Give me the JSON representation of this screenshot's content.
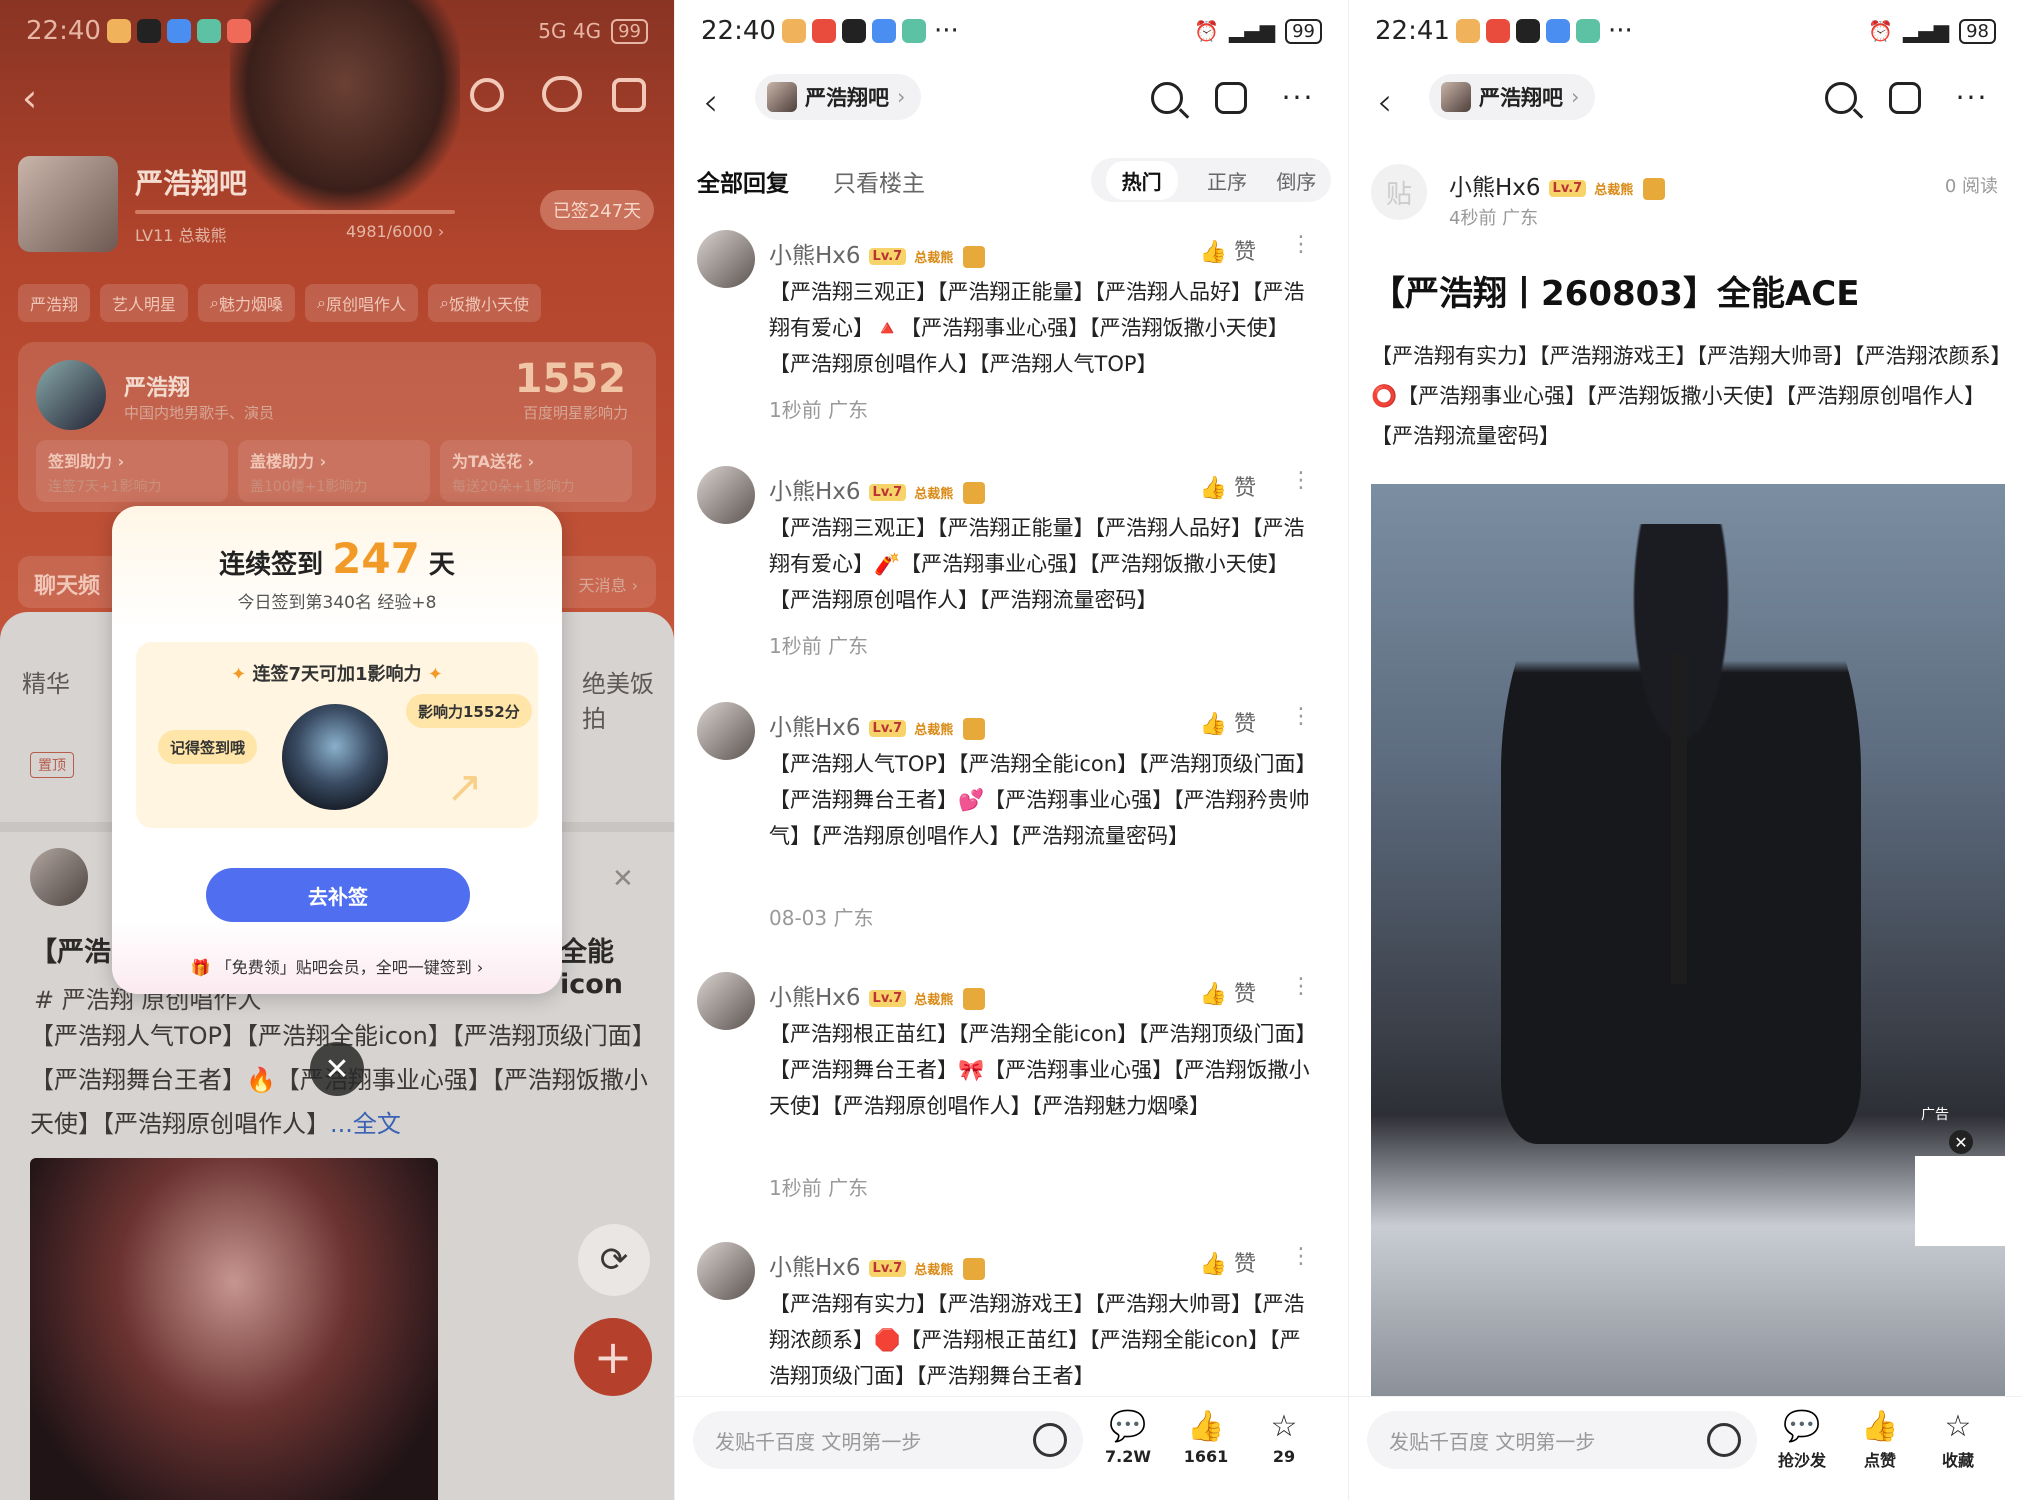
{
  "screens": [
    {
      "status": {
        "time": "22:40",
        "net": "5G 4G",
        "battery": "99"
      },
      "forum": {
        "name": "严浩翔吧",
        "level": "LV11 总裁熊",
        "exp": "4981/6000 ›",
        "signed": "已签247天"
      },
      "tags": [
        "严浩翔",
        "艺人明星",
        "魅力烟嗓",
        "原创唱作人",
        "饭撒小天使"
      ],
      "star_card": {
        "name": "严浩翔",
        "desc": "中国内地男歌手、演员",
        "score": "1552",
        "score_label": "百度明星影响力",
        "actions": [
          {
            "title": "签到助力 ›",
            "sub": "连签7天+1影响力"
          },
          {
            "title": "盖楼助力 ›",
            "sub": "盖100楼+1影响力"
          },
          {
            "title": "为TA送花 ›",
            "sub": "每送20朵+1影响力"
          }
        ]
      },
      "chat": {
        "label": "聊天频",
        "right": "天消息 ›"
      },
      "tabs": {
        "first": "精华",
        "last": "绝美饭拍"
      },
      "pin": "置顶",
      "post": {
        "title": "【严浩",
        "title_tail": "全能icon",
        "hashtag": "# 严浩翔 原创唱作人",
        "text": "【严浩翔人气TOP】【严浩翔全能icon】【严浩翔顶级门面】【严浩翔舞台王者】🔥【严浩翔事业心强】【严浩翔饭撒小天使】【严浩翔原创唱作人】",
        "more": "...全文"
      },
      "modal": {
        "title_pre": "连续签到",
        "days": "247",
        "title_post": "天",
        "sub": "今日签到第340名 经验+8",
        "box_title": "连签7天可加1影响力",
        "chip_left": "记得签到哦",
        "chip_right": "影响力1552分",
        "button": "去补签",
        "footer": "「免费领」贴吧会员，全吧一键签到 ›"
      }
    },
    {
      "status": {
        "time": "22:40",
        "battery": "99"
      },
      "forum_pill": "严浩翔吧",
      "tabs": {
        "all": "全部回复",
        "op": "只看楼主",
        "seg": [
          "热门",
          "正序",
          "倒序"
        ]
      },
      "replies": [
        {
          "name": "小熊Hx6",
          "lv": "Lv.7",
          "badge": "总裁熊",
          "like": "赞",
          "text": "【严浩翔三观正】【严浩翔正能量】【严浩翔人品好】【严浩翔有爱心】🔺【严浩翔事业心强】【严浩翔饭撒小天使】【严浩翔原创唱作人】【严浩翔人气TOP】",
          "meta": "1秒前  广东"
        },
        {
          "name": "小熊Hx6",
          "lv": "Lv.7",
          "badge": "总裁熊",
          "like": "赞",
          "text": "【严浩翔三观正】【严浩翔正能量】【严浩翔人品好】【严浩翔有爱心】🧨【严浩翔事业心强】【严浩翔饭撒小天使】【严浩翔原创唱作人】【严浩翔流量密码】",
          "meta": "1秒前  广东"
        },
        {
          "name": "小熊Hx6",
          "lv": "Lv.7",
          "badge": "总裁熊",
          "like": "赞",
          "text": "【严浩翔人气TOP】【严浩翔全能icon】【严浩翔顶级门面】【严浩翔舞台王者】💕【严浩翔事业心强】【严浩翔矜贵帅气】【严浩翔原创唱作人】【严浩翔流量密码】",
          "meta": "08-03  广东"
        },
        {
          "name": "小熊Hx6",
          "lv": "Lv.7",
          "badge": "总裁熊",
          "like": "赞",
          "text": "【严浩翔根正苗红】【严浩翔全能icon】【严浩翔顶级门面】【严浩翔舞台王者】🎀【严浩翔事业心强】【严浩翔饭撒小天使】【严浩翔原创唱作人】【严浩翔魅力烟嗓】",
          "meta": "1秒前  广东"
        },
        {
          "name": "小熊Hx6",
          "lv": "Lv.7",
          "badge": "总裁熊",
          "like": "赞",
          "text": "【严浩翔有实力】【严浩翔游戏王】【严浩翔大帅哥】【严浩翔浓颜系】🛑【严浩翔根正苗红】【严浩翔全能icon】【严浩翔顶级门面】【严浩翔舞台王者】",
          "meta": ""
        }
      ],
      "bottom": {
        "placeholder": "发贴千百度 文明第一步",
        "comments": "7.2W",
        "likes": "1661",
        "stars": "29"
      }
    },
    {
      "status": {
        "time": "22:41",
        "battery": "98"
      },
      "forum_pill": "严浩翔吧",
      "author": {
        "name": "小熊Hx6",
        "lv": "Lv.7",
        "badge": "总裁熊",
        "meta": "4秒前  广东",
        "reads": "0 阅读",
        "avatar_char": "贴"
      },
      "title": "【严浩翔丨260803】全能ACE",
      "body": "【严浩翔有实力】【严浩翔游戏王】【严浩翔大帅哥】【严浩翔浓颜系】⭕【严浩翔事业心强】【严浩翔饭撒小天使】【严浩翔原创唱作人】【严浩翔流量密码】",
      "ad": "广告",
      "bottom": {
        "placeholder": "发贴千百度 文明第一步",
        "sofa": "抢沙发",
        "like": "点赞",
        "fav": "收藏"
      }
    }
  ]
}
